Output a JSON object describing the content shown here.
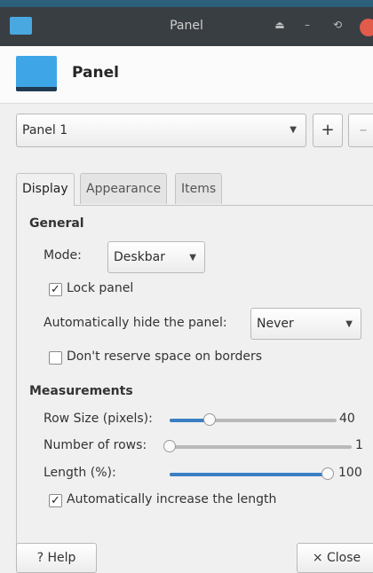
{
  "window": {
    "title": "Panel",
    "buttons": [
      "⏏",
      "–",
      "⟲"
    ]
  },
  "header": {
    "title": "Panel"
  },
  "panel_select": {
    "value": "Panel 1",
    "add_label": "+",
    "remove_label": "–"
  },
  "tabs": [
    "Display",
    "Appearance",
    "Items"
  ],
  "general": {
    "heading": "General",
    "mode_label": "Mode:",
    "mode_value": "Deskbar",
    "lock_label": "Lock panel",
    "lock_checked": true,
    "autohide_label": "Automatically hide the panel:",
    "autohide_value": "Never",
    "reserve_label": "Don't reserve space on borders",
    "reserve_checked": false
  },
  "measurements": {
    "heading": "Measurements",
    "row_size_label": "Row Size (pixels):",
    "row_size_value": "40",
    "row_size_fraction": 0.24,
    "rows_label": "Number of rows:",
    "rows_value": "1",
    "rows_fraction": 0.0,
    "length_label": "Length (%):",
    "length_value": "100",
    "length_fraction": 1.0,
    "auto_length_label": "Automatically increase the length",
    "auto_length_checked": true
  },
  "footer": {
    "help_label": "? Help",
    "close_label": "× Close"
  },
  "colors": {
    "accent": "#3a7fc4",
    "titlebar": "#393e43",
    "icon": "#3ea6e6",
    "close": "#e25b4b"
  }
}
